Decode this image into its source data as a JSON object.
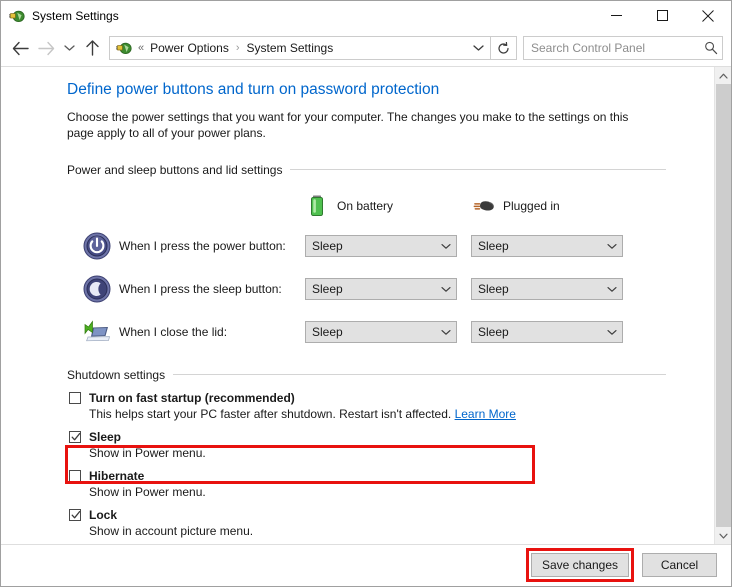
{
  "window": {
    "title": "System Settings",
    "title_icon": "power-options-icon",
    "controls": {
      "minimize": "minimize-button",
      "maximize": "maximize-button",
      "close": "close-button"
    }
  },
  "nav": {
    "back": "back-arrow-icon",
    "forward": "forward-arrow-icon",
    "recent": "recent-locations-chevron-icon",
    "up": "up-arrow-icon",
    "address_icon": "power-options-icon",
    "overflow": "previous-locations-chevrons",
    "breadcrumbs": [
      {
        "label": "Power Options"
      },
      {
        "label": "System Settings"
      }
    ],
    "separator": "›",
    "dropdown_icon": "chevron-down-icon",
    "refresh_icon": "refresh-icon"
  },
  "search": {
    "placeholder": "Search Control Panel",
    "icon": "search-icon"
  },
  "page": {
    "title": "Define power buttons and turn on password protection",
    "description": "Choose the power settings that you want for your computer. The changes you make to the settings on this page apply to all of your power plans."
  },
  "sections": {
    "power_buttons": {
      "header": "Power and sleep buttons and lid settings",
      "columns": [
        {
          "label": "On battery",
          "icon": "battery-icon"
        },
        {
          "label": "Plugged in",
          "icon": "power-plug-icon"
        }
      ],
      "rows": [
        {
          "icon": "power-button-icon",
          "label": "When I press the power button:",
          "on_battery": "Sleep",
          "plugged_in": "Sleep"
        },
        {
          "icon": "sleep-moon-icon",
          "label": "When I press the sleep button:",
          "on_battery": "Sleep",
          "plugged_in": "Sleep"
        },
        {
          "icon": "laptop-lid-icon",
          "label": "When I close the lid:",
          "on_battery": "Sleep",
          "plugged_in": "Sleep"
        }
      ]
    },
    "shutdown": {
      "header": "Shutdown settings",
      "options": [
        {
          "title": "Turn on fast startup (recommended)",
          "description": "This helps start your PC faster after shutdown. Restart isn't affected. ",
          "link": "Learn More",
          "checked": false,
          "highlighted": true
        },
        {
          "title": "Sleep",
          "description": "Show in Power menu.",
          "link": "",
          "checked": true,
          "highlighted": false
        },
        {
          "title": "Hibernate",
          "description": "Show in Power menu.",
          "link": "",
          "checked": false,
          "highlighted": false
        },
        {
          "title": "Lock",
          "description": "Show in account picture menu.",
          "link": "",
          "checked": true,
          "highlighted": false
        }
      ]
    }
  },
  "footer": {
    "save_label": "Save changes",
    "cancel_label": "Cancel",
    "save_highlighted": true
  },
  "scrollbar": {
    "up_icon": "scroll-up-icon",
    "down_icon": "scroll-down-icon"
  },
  "colors": {
    "link": "#0066cc",
    "highlight": "#e8120f",
    "control_bg": "#e1e1e1",
    "control_border": "#adadad"
  }
}
